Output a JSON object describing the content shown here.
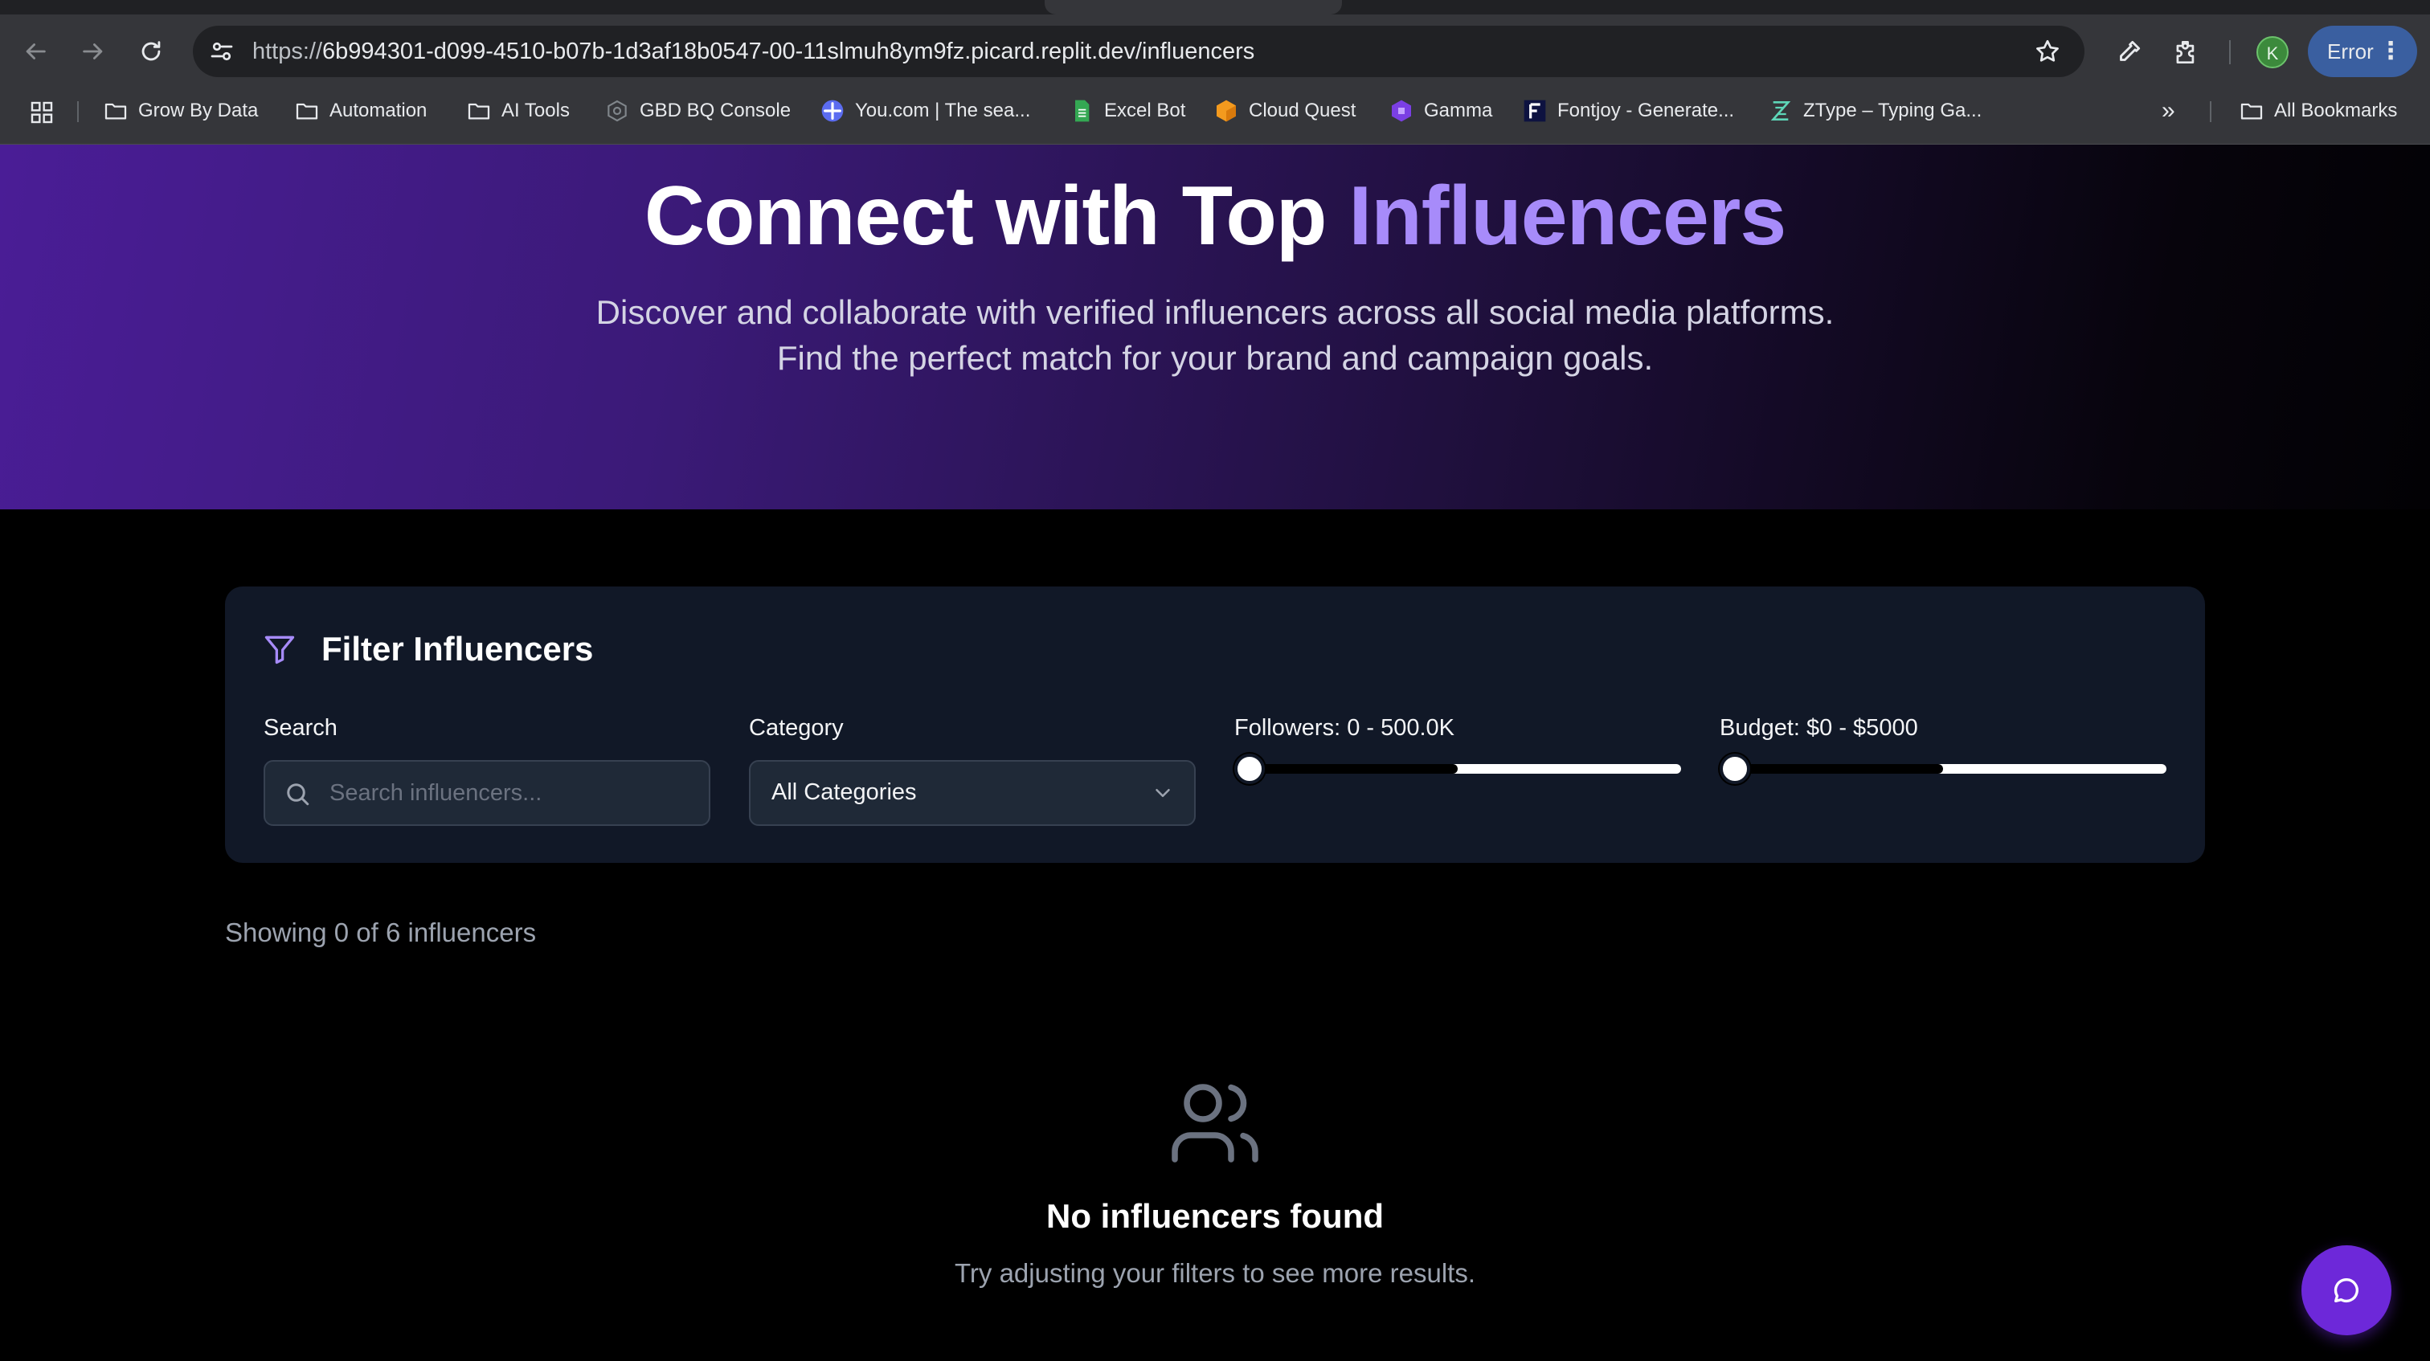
{
  "browser": {
    "url_scheme": "https://",
    "url_host": "6b994301-d099-4510-b07b-1d3af18b0547-00-11slmuh8ym9fz.picard.replit.dev",
    "url_path": "/influencers",
    "profile_initial": "K",
    "error_label": "Error",
    "more_label": "»",
    "bookmarks": [
      {
        "label": "Grow By Data",
        "icon": "folder-icon"
      },
      {
        "label": "Automation",
        "icon": "folder-icon"
      },
      {
        "label": "AI Tools",
        "icon": "folder-icon"
      },
      {
        "label": "GBD BQ Console",
        "icon": "bigquery-icon"
      },
      {
        "label": "You.com | The sea...",
        "icon": "youcom-icon"
      },
      {
        "label": "Excel Bot",
        "icon": "sheet-icon"
      },
      {
        "label": "Cloud Quest",
        "icon": "cube-icon"
      },
      {
        "label": "Gamma",
        "icon": "gamma-icon"
      },
      {
        "label": "Fontjoy - Generate...",
        "icon": "fontjoy-icon"
      },
      {
        "label": "ZType – Typing Ga...",
        "icon": "ztype-icon"
      }
    ],
    "all_bookmarks": "All Bookmarks"
  },
  "hero": {
    "title_prefix": "Connect with Top ",
    "title_accent": "Influencers",
    "subtitle": "Discover and collaborate with verified influencers across all social media platforms. Find the perfect match for your brand and campaign goals."
  },
  "filters": {
    "title": "Filter Influencers",
    "search_label": "Search",
    "search_placeholder": "Search influencers...",
    "category_label": "Category",
    "category_value": "All Categories",
    "followers_label": "Followers: 0 - 500.0K",
    "followers_range": [
      0,
      500000
    ],
    "budget_label": "Budget: $0 - $5000",
    "budget_range": [
      0,
      5000
    ]
  },
  "results": {
    "showing": "Showing 0 of 6 influencers",
    "empty_title": "No influencers found",
    "empty_subtitle": "Try adjusting your filters to see more results."
  },
  "colors": {
    "accent": "#a78bfa",
    "chat_button": "#6d28d9",
    "panel": "#111827"
  }
}
